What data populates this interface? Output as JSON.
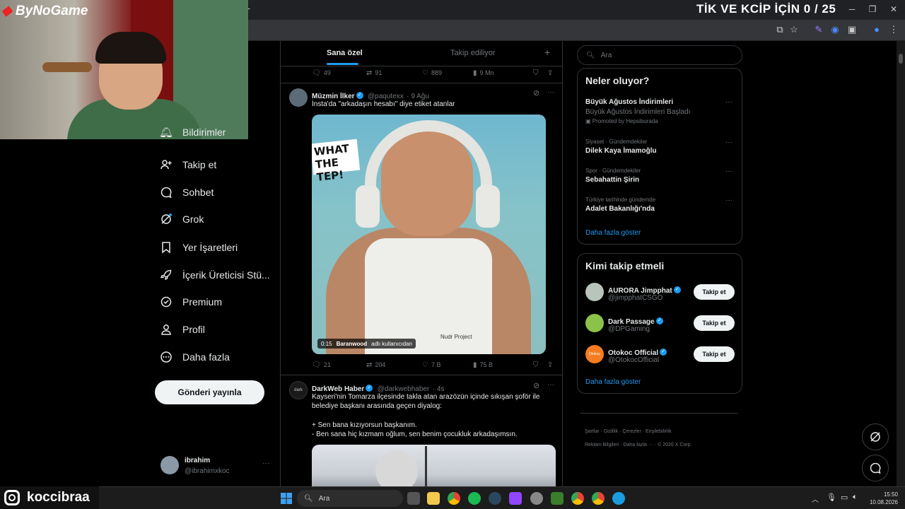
{
  "overlay": {
    "brand": "ByNoGame",
    "goal_text": "TİK VE KCİP İÇİN 0 / 25",
    "streamer": "koccibraa"
  },
  "nav": {
    "items": [
      {
        "label": "Bildirimler",
        "icon": "bell-icon"
      },
      {
        "label": "Takip et",
        "icon": "add-user-icon"
      },
      {
        "label": "Sohbet",
        "icon": "chat-icon"
      },
      {
        "label": "Grok",
        "icon": "grok-icon"
      },
      {
        "label": "Yer İşaretleri",
        "icon": "bookmark-icon"
      },
      {
        "label": "İçerik Üreticisi Stü...",
        "icon": "rocket-icon"
      },
      {
        "label": "Premium",
        "icon": "premium-icon"
      },
      {
        "label": "Profil",
        "icon": "person-icon"
      },
      {
        "label": "Daha fazla",
        "icon": "more-circle-icon"
      }
    ],
    "post_button": "Gönderi yayınla",
    "profile": {
      "name": "ibrahim",
      "handle": "@ibrahimxkoc"
    }
  },
  "feed": {
    "tabs": [
      "Sana özel",
      "Takip ediliyor"
    ],
    "prev_actions": {
      "replies": "49",
      "reposts": "91",
      "likes": "889",
      "views": "9 Mn"
    },
    "tweet1": {
      "name": "Müzmin İlker",
      "handle": "@paqutexx",
      "time": "· 9 Ağu",
      "text": "İnsta'da \"arkadaşın hesabı\" diye etiket atanlar",
      "sticker": "WHAT THE TEP!",
      "video_time": "0:15",
      "video_user": "Baranwood",
      "video_caption": "adlı kullanıcıdan",
      "shirt_text": "Nudr Project",
      "actions": {
        "replies": "21",
        "reposts": "204",
        "likes": "7 B",
        "views": "75 B"
      }
    },
    "tweet2": {
      "name": "DarkWeb Haber",
      "handle": "@darkwebhaber",
      "time": "· 4s",
      "avatar_text": "dark",
      "line1": "Kayseri'nin Tomarza ilçesinde takla atan arazözün içinde sıkışan şoför ile",
      "line2": "belediye başkanı arasında geçen diyalog:",
      "line3": "+ Sen bana kızıyorsun başkanım.",
      "line4": "- Ben sana hiç kızmam oğlum, sen benim çocukluk arkadaşımsın."
    }
  },
  "sidebar": {
    "search_placeholder": "Ara",
    "trends_title": "Neler oluyor?",
    "promo": {
      "name": "Büyük Ağustos İndirimleri",
      "sub": "Büyük Ağustos İndirimleri Başladı",
      "promoted": "Promoted by Hepsiburada"
    },
    "trends": [
      {
        "meta": "Siyaset · Gündemdekiler",
        "name": "Dilek Kaya İmamoğlu"
      },
      {
        "meta": "Spor · Gündemdekiler",
        "name": "Sebahattin Şirin"
      },
      {
        "meta": "Türkiye tarihinde gündemde",
        "name": "Adalet Bakanlığı'nda"
      }
    ],
    "show_more": "Daha fazla göster",
    "who_title": "Kimi takip etmeli",
    "who": [
      {
        "name": "AURORA Jimpphat",
        "handle": "@jimpphatCSGO",
        "button": "Takip et",
        "avatar_color": "#b9c4bd"
      },
      {
        "name": "Dark Passage",
        "handle": "@DPGaming",
        "button": "Takip et",
        "avatar_color": "#8bc34a"
      },
      {
        "name": "Otokoc Official",
        "handle": "@OtokocOfficial",
        "button": "Takip et",
        "avatar_color": "#f57c20",
        "avatar_text": "Otokoç"
      }
    ],
    "who_more": "Daha fazla göster",
    "footer": [
      "Şartlar",
      "Gizlilik",
      "Çerezler",
      "Erişilebilirlik",
      "Reklam Bilgileri",
      "Daha fazla ···",
      "© 2026 X Corp."
    ]
  },
  "taskbar": {
    "search": "Ara",
    "time": "15:50",
    "date": "10.08.2026"
  },
  "colors": {
    "accent": "#1d9bf0",
    "background": "#000000",
    "border": "#2f3336"
  }
}
